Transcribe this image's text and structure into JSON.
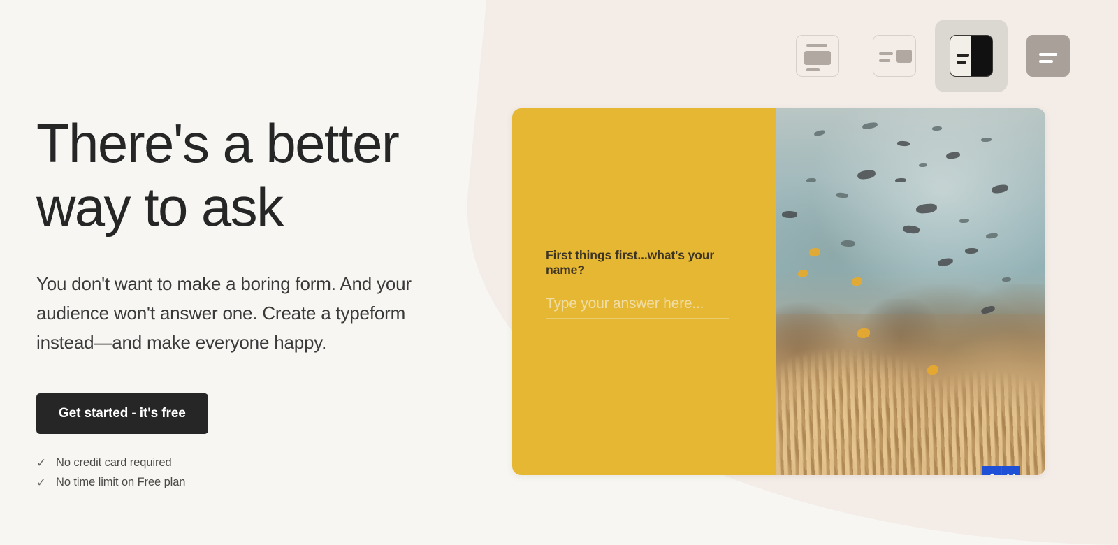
{
  "page": {
    "background_color": "#f7f6f2",
    "accent_blob_color": "#f4ece7"
  },
  "layout_switcher": {
    "name": "layout-switcher",
    "options": [
      {
        "id": "stacked",
        "icon": "layout-stacked-icon",
        "selected": false,
        "style": "outline"
      },
      {
        "id": "side-by-side",
        "icon": "layout-side-by-side-icon",
        "selected": false,
        "style": "outline"
      },
      {
        "id": "split-screen",
        "icon": "layout-split-screen-icon",
        "selected": true,
        "style": "split"
      },
      {
        "id": "full-background",
        "icon": "layout-full-background-icon",
        "selected": false,
        "style": "solid"
      }
    ]
  },
  "hero": {
    "headline": "There's a better\nway to ask",
    "subcopy": "You don't want to make a boring form. And your audience won't answer one. Create a typeform instead—and make everyone happy.",
    "cta_label": "Get started - it's free",
    "cta_background": "#262627",
    "benefits": [
      {
        "check": "✓",
        "label": "No credit card required"
      },
      {
        "check": "✓",
        "label": "No time limit on Free plan"
      }
    ]
  },
  "form_preview": {
    "panel_color": "#e5b733",
    "question": "First things first...what's your name?",
    "answer_value": "",
    "answer_placeholder": "Type your answer here...",
    "image_alt": "underwater coral reef with tropical fish",
    "nav": {
      "up_label": "˄",
      "down_label": "˅",
      "color": "#1d4fd7"
    }
  }
}
